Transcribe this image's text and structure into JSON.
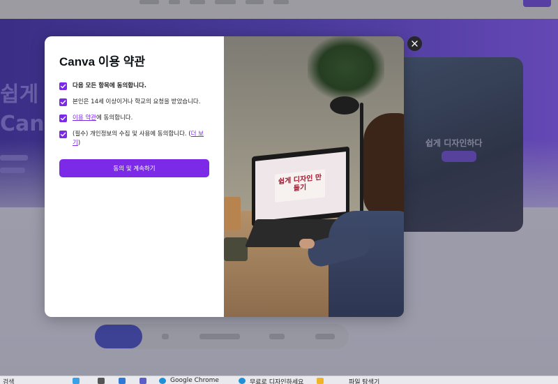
{
  "background": {
    "hero_text": "쉽게 디자인 만드는\nCanva",
    "card_text": "쉽게 디자인하다"
  },
  "modal": {
    "title": "Canva 이용 약관",
    "consents": [
      {
        "label": "다음 모든 항목에 동의합니다.",
        "checked": true
      },
      {
        "label": "본인은 14세 이상이거나 학교의 요청을 받았습니다.",
        "checked": true
      },
      {
        "label_link": "이용 약관",
        "label_rest": "에 동의합니다.",
        "checked": true
      },
      {
        "label": "(필수) 개인정보의 수집 및 사용에 동의합니다. (",
        "label_link": "더 보기",
        "label_tail": ")",
        "checked": true
      }
    ],
    "continue_label": "동의 및 계속하기",
    "close_icon": "close-icon",
    "image_text": "쉽게 디자인 만들기"
  },
  "taskbar": {
    "search_label": "검색",
    "items": [
      "Google Chrome",
      "무료로 디자인하세요",
      "파일 탐색기"
    ]
  },
  "colors": {
    "accent": "#7d2ae8",
    "title": "#0e1318"
  }
}
